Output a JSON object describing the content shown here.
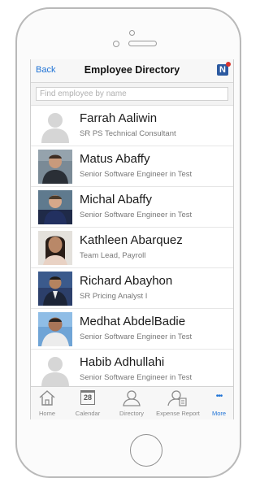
{
  "navbar": {
    "back_label": "Back",
    "title": "Employee Directory",
    "badge_letter": "N"
  },
  "search": {
    "placeholder": "Find employee by name"
  },
  "employees": [
    {
      "name": "Farrah Aaliwin",
      "title": "SR PS Technical Consultant",
      "photo": "placeholder"
    },
    {
      "name": "Matus Abaffy",
      "title": "Senior Software Engineer in Test",
      "photo": "photo"
    },
    {
      "name": "Michal Abaffy",
      "title": "Senior Software Engineer in Test",
      "photo": "photo"
    },
    {
      "name": "Kathleen Abarquez",
      "title": "Team Lead, Payroll",
      "photo": "photo"
    },
    {
      "name": "Richard Abayhon",
      "title": "SR Pricing Analyst I",
      "photo": "photo"
    },
    {
      "name": "Medhat AbdelBadie",
      "title": "Senior Software Engineer in Test",
      "photo": "photo"
    },
    {
      "name": "Habib Adhullahi",
      "title": "Senior Software Engineer in Test",
      "photo": "placeholder"
    }
  ],
  "tabs": [
    {
      "label": "Home",
      "icon": "home-icon"
    },
    {
      "label": "Calendar",
      "icon": "calendar-icon",
      "calendar_day": "28"
    },
    {
      "label": "Directory",
      "icon": "person-icon"
    },
    {
      "label": "Expense Report",
      "icon": "expense-icon"
    },
    {
      "label": "More",
      "icon": "more-icon",
      "glyph": "•••"
    }
  ],
  "colors": {
    "accent": "#1f73d6",
    "badge": "#d9342b",
    "brand_icon": "#2c5aa0"
  }
}
